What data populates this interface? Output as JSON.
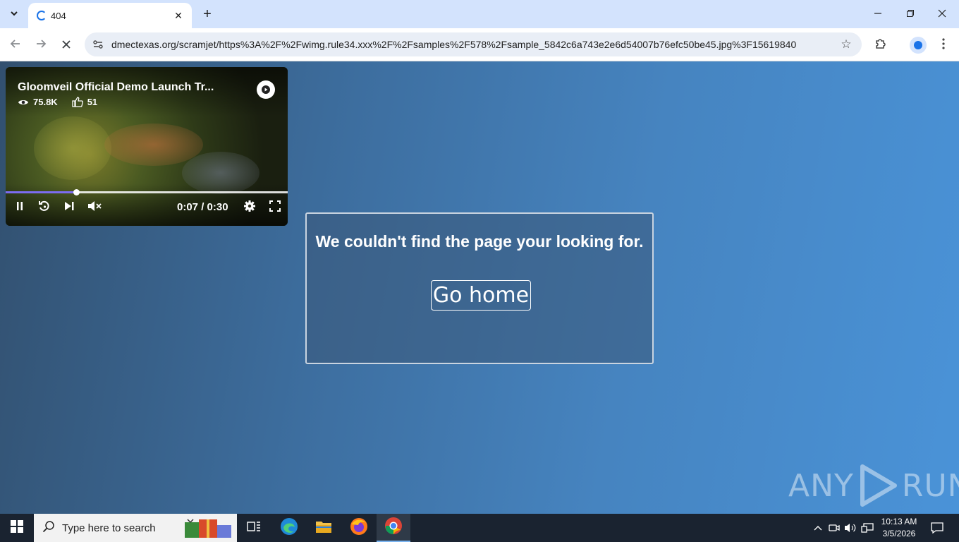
{
  "browser": {
    "tab_title": "404",
    "url": "dmectexas.org/scramjet/https%3A%2F%2Fwimg.rule34.xxx%2F%2Fsamples%2F578%2Fsample_5842c6a743e2e6d54007b76efc50be45.jpg%3F15619840"
  },
  "video": {
    "title": "Gloomveil Official Demo Launch Tr...",
    "views": "75.8K",
    "likes": "51",
    "time": "0:07 / 0:30",
    "progress_fraction": 0.25
  },
  "card": {
    "message": "We couldn't find the page your looking for.",
    "button_label": "Go home"
  },
  "watermark": {
    "left": "ANY",
    "right": "RUN"
  },
  "taskbar": {
    "search_placeholder": "Type here to search",
    "time": "10:13 AM",
    "date": "3/5/2026"
  },
  "colors": {
    "accent": "#1a73e8",
    "progress": "#7c6cf0",
    "page_bg_left": "#32506f",
    "page_bg_right": "#4a93d8"
  }
}
